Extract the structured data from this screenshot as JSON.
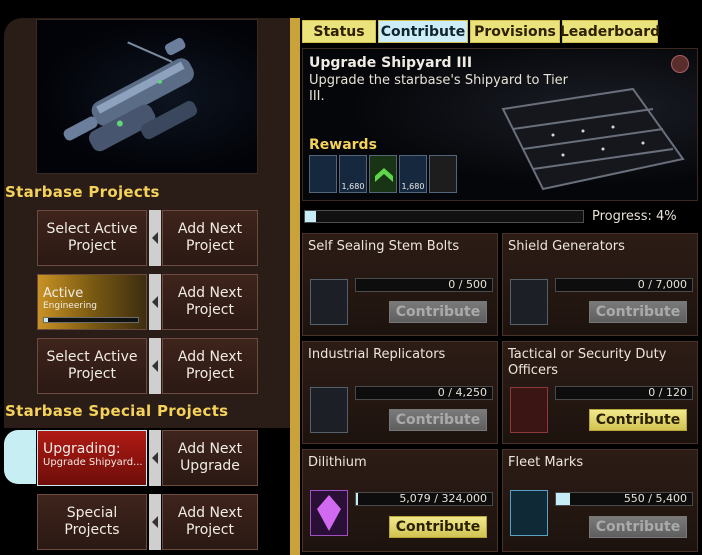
{
  "left": {
    "starbase_projects_title": "Starbase Projects",
    "starbase_special_title": "Starbase Special Projects",
    "rows": [
      {
        "left_label": "Select Active Project",
        "right_label": "Add Next Project"
      },
      {
        "active_title": "Active",
        "active_subtitle": "Engineering",
        "active_progress_pct": 4,
        "right_label": "Add Next Project"
      },
      {
        "left_label": "Select Active Project",
        "right_label": "Add Next Project"
      }
    ],
    "special_rows": [
      {
        "upgrade_title": "Upgrading:",
        "upgrade_subtitle": "Upgrade Shipyard...",
        "right_label": "Add Next Upgrade"
      },
      {
        "left_label": "Special Projects",
        "right_label": "Add Next Project"
      }
    ]
  },
  "tabs": [
    {
      "label": "Status",
      "active": false
    },
    {
      "label": "Contribute",
      "active": true
    },
    {
      "label": "Provisions",
      "active": false
    },
    {
      "label": "Leaderboard",
      "active": false
    }
  ],
  "project": {
    "title": "Upgrade Shipyard III",
    "description": "Upgrade the starbase's Shipyard to Tier III.",
    "rewards_label": "Rewards",
    "rewards": [
      {
        "icon": "fleet-credit-icon",
        "amount": ""
      },
      {
        "icon": "fleet-credit-icon",
        "amount": "1,680"
      },
      {
        "icon": "rank-chevron-icon",
        "amount": ""
      },
      {
        "icon": "fleet-credit-icon",
        "amount": "1,680"
      },
      {
        "icon": "wrench-icon",
        "amount": ""
      }
    ]
  },
  "progress": {
    "label": "Progress: 4%",
    "value_pct": 4
  },
  "cards": [
    {
      "title": "Self Sealing Stem Bolts",
      "icon": "stem-bolts-icon",
      "value": "0 / 500",
      "fill": 0,
      "button": "Contribute",
      "enabled": false
    },
    {
      "title": "Shield Generators",
      "icon": "shield-generator-icon",
      "value": "0 / 7,000",
      "fill": 0,
      "button": "Contribute",
      "enabled": false
    },
    {
      "title": "Industrial Replicators",
      "icon": "replicator-icon",
      "value": "0 / 4,250",
      "fill": 0,
      "button": "Contribute",
      "enabled": false
    },
    {
      "title": "Tactical or Security Duty Officers",
      "icon": "duty-officer-icon",
      "value": "0 / 120",
      "fill": 0,
      "button": "Contribute",
      "enabled": true
    },
    {
      "title": "Dilithium",
      "icon": "dilithium-crystal-icon",
      "value": "5,079 / 324,000",
      "fill": 0.016,
      "button": "Contribute",
      "enabled": true
    },
    {
      "title": "Fleet Marks",
      "icon": "fleet-marks-icon",
      "value": "550 / 5,400",
      "fill": 0.1,
      "button": "Contribute",
      "enabled": false
    }
  ]
}
